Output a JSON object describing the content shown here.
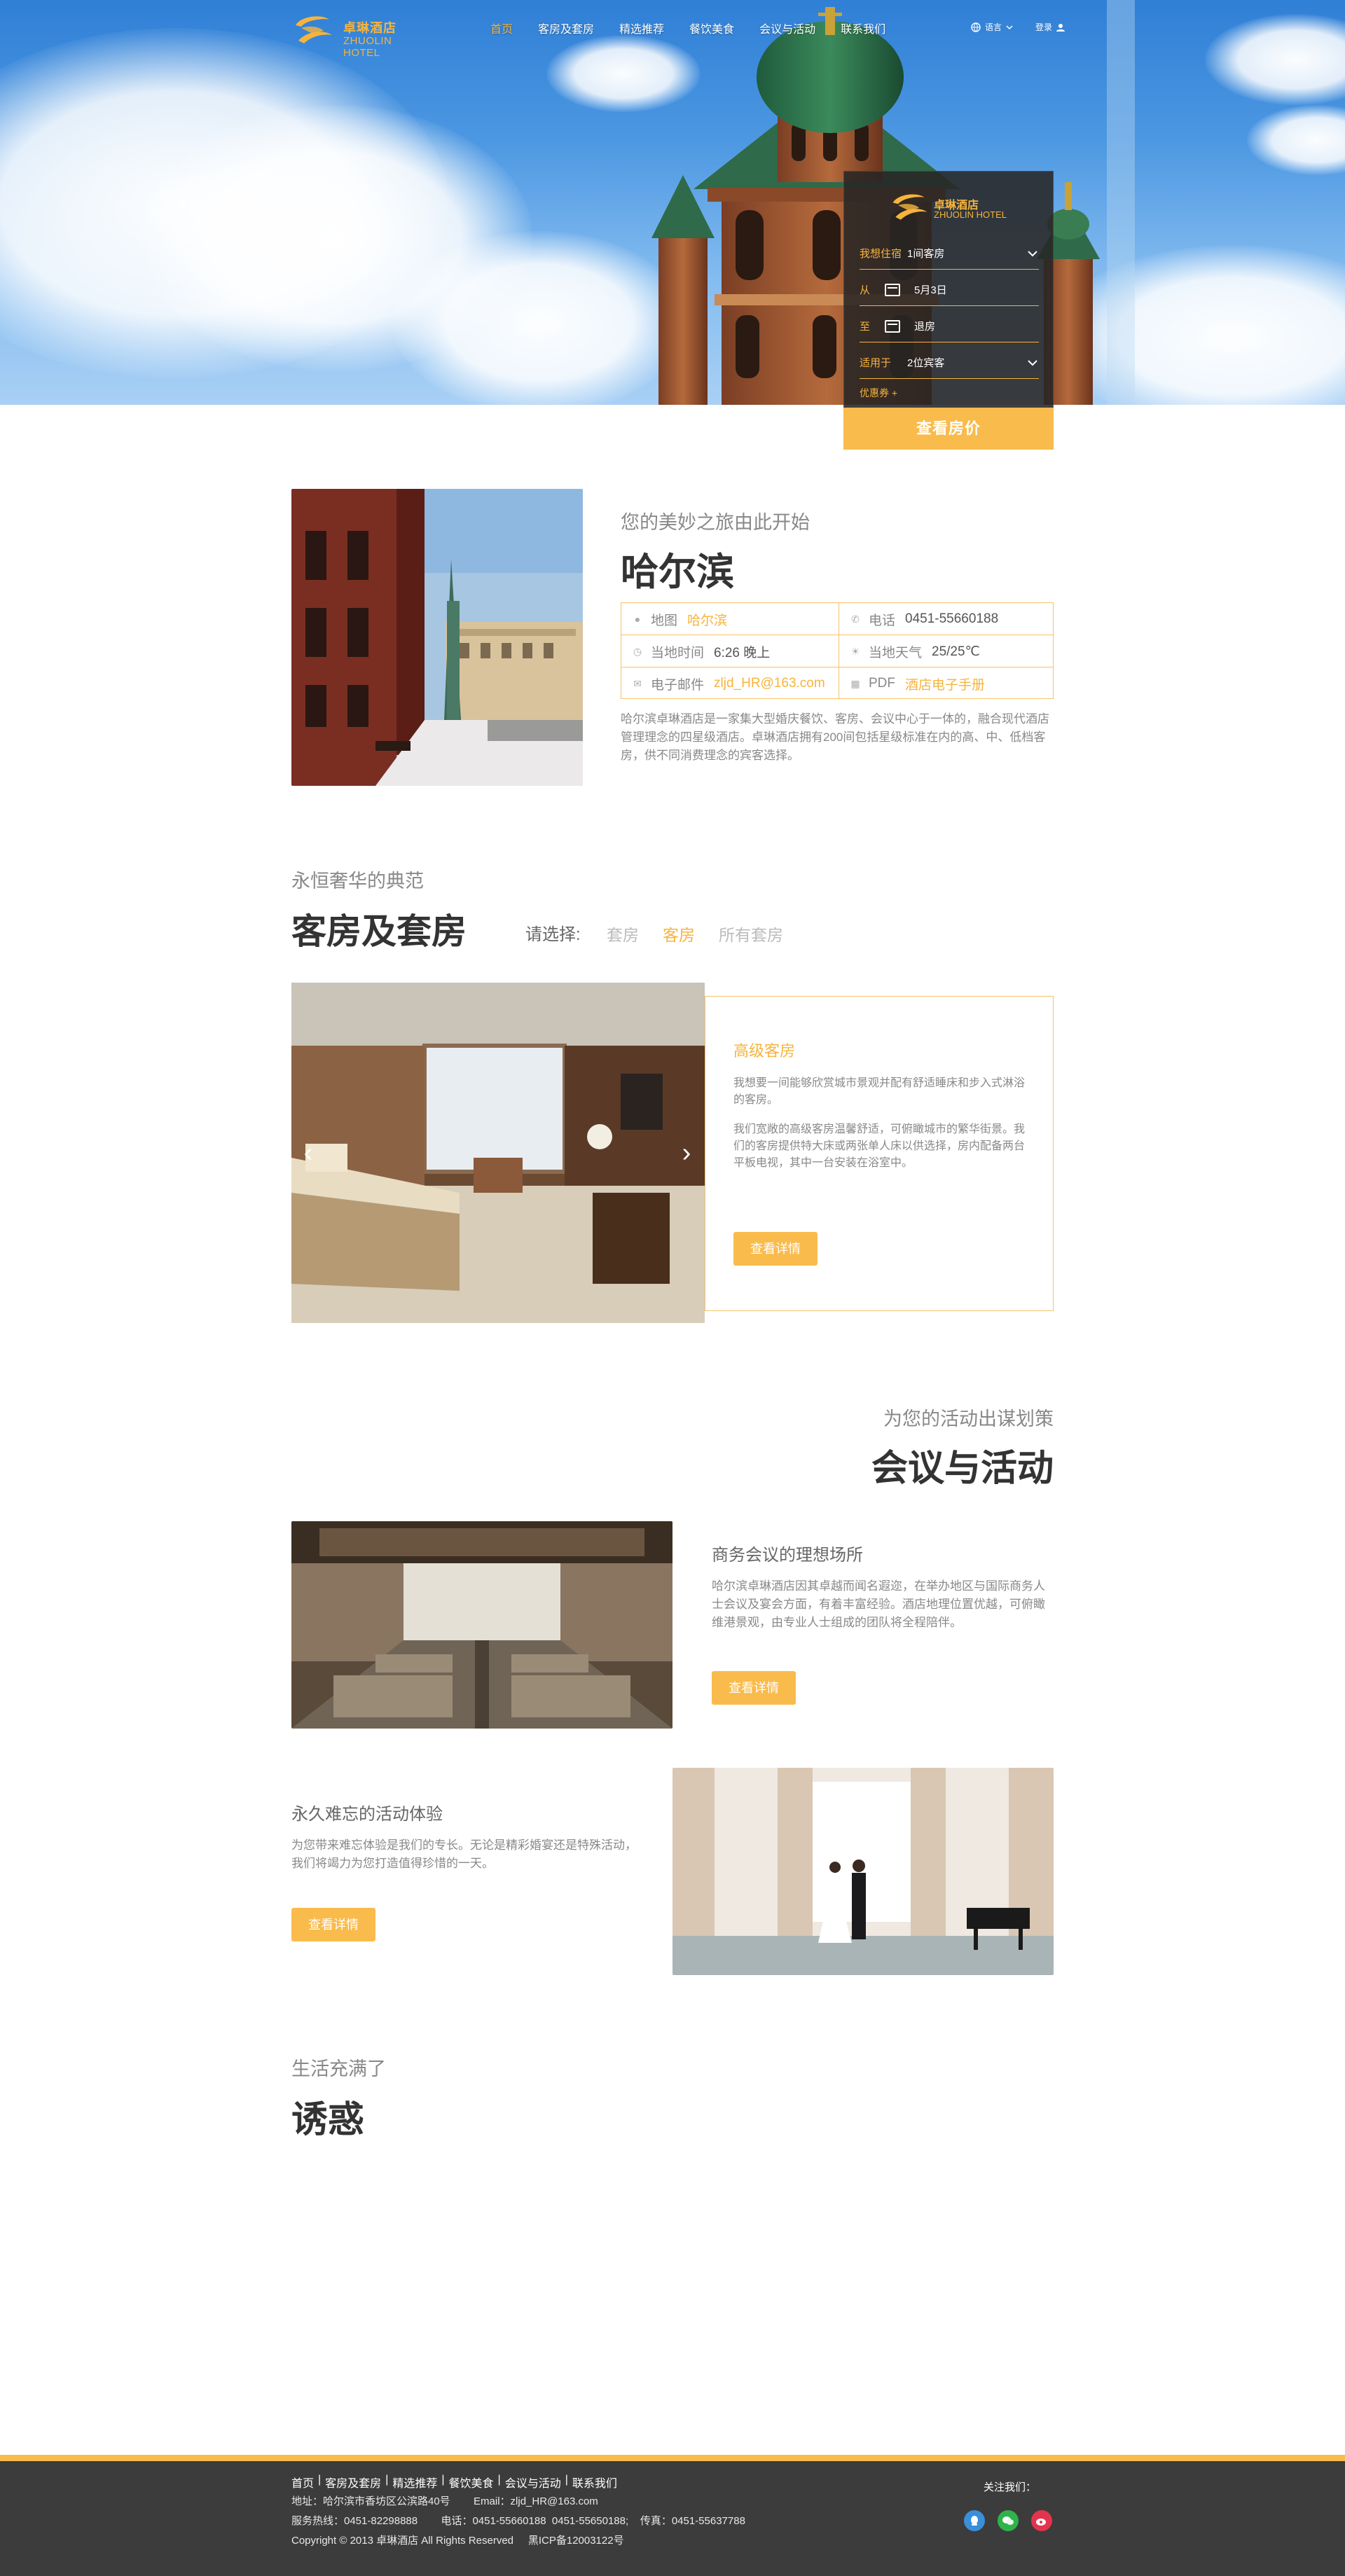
{
  "brand": {
    "cn": "卓琳酒店",
    "en": "ZHUOLIN HOTEL"
  },
  "nav": {
    "items": [
      "首页",
      "客房及套房",
      "精选推荐",
      "餐饮美食",
      "会议与活动",
      "联系我们"
    ],
    "lang": "语言",
    "login": "登录"
  },
  "booking": {
    "stay_label": "我想住宿",
    "stay_value": "1间客房",
    "from_label": "从",
    "from_value": "5月3日",
    "to_label": "至",
    "to_value": "退房",
    "for_label": "适用于",
    "for_value": "2位宾客",
    "promo": "优惠券 +",
    "submit": "查看房价"
  },
  "intro": {
    "subtitle": "您的美妙之旅由此开始",
    "title": "哈尔滨",
    "map_label": "地图",
    "map_value": "哈尔滨",
    "phone_label": "电话",
    "phone_value": "0451-55660188",
    "time_label": "当地时间",
    "time_value": "6:26 晚上",
    "weather_label": "当地天气",
    "weather_value": "25/25℃",
    "email_label": "电子邮件",
    "email_value": "zljd_HR@163.com",
    "pdf_label": "PDF",
    "pdf_value": "酒店电子手册",
    "desc": "哈尔滨卓琳酒店是一家集大型婚庆餐饮、客房、会议中心于一体的，融合现代酒店管理理念的四星级酒店。卓琳酒店拥有200间包括星级标准在内的高、中、低档客房，供不同消费理念的宾客选择。"
  },
  "rooms": {
    "subtitle": "永恒奢华的典范",
    "title": "客房及套房",
    "filter_label": "请选择:",
    "filters": [
      "套房",
      "客房",
      "所有套房"
    ],
    "active_filter": "客房",
    "card_title": "高级客房",
    "card_p1": "我想要一间能够欣赏城市景观并配有舒适睡床和步入式淋浴的客房。",
    "card_p2": "我们宽敞的高级客房温馨舒适，可俯瞰城市的繁华街景。我们的客房提供特大床或两张单人床以供选择，房内配备两台平板电视，其中一台安装在浴室中。",
    "card_button": "查看详情"
  },
  "events": {
    "subtitle": "为您的活动出谋划策",
    "title": "会议与活动",
    "item1_title": "商务会议的理想场所",
    "item1_text": "哈尔滨卓琳酒店因其卓越而闻名遐迩，在举办地区与国际商务人士会议及宴会方面，有着丰富经验。酒店地理位置优越，可俯瞰维港景观，由专业人士组成的团队将全程陪伴。",
    "item1_button": "查看详情",
    "item2_title": "永久难忘的活动体验",
    "item2_text": "为您带来难忘体验是我们的专长。无论是精彩婚宴还是特殊活动，我们将竭力为您打造值得珍惜的一天。",
    "item2_button": "查看详情"
  },
  "life": {
    "subtitle": "生活充满了",
    "title": "诱惑"
  },
  "footer": {
    "nav": [
      "首页",
      "客房及套房",
      "精选推荐",
      "餐饮美食",
      "会议与活动",
      "联系我们"
    ],
    "address": "地址：哈尔滨市香坊区公滨路40号        Email：zljd_HR@163.com",
    "hotline": "服务热线：0451-82298888        电话：0451-55660188  0451-55650188;    传真：0451-55637788",
    "copyright": "Copyright © 2013 卓琳酒店 All Rights Reserved     黑ICP备12003122号",
    "follow": "关注我们："
  },
  "colors": {
    "accent": "#f9bb4c",
    "accent_text": "#f6b43c",
    "footer_bg": "#3c3c3c"
  }
}
